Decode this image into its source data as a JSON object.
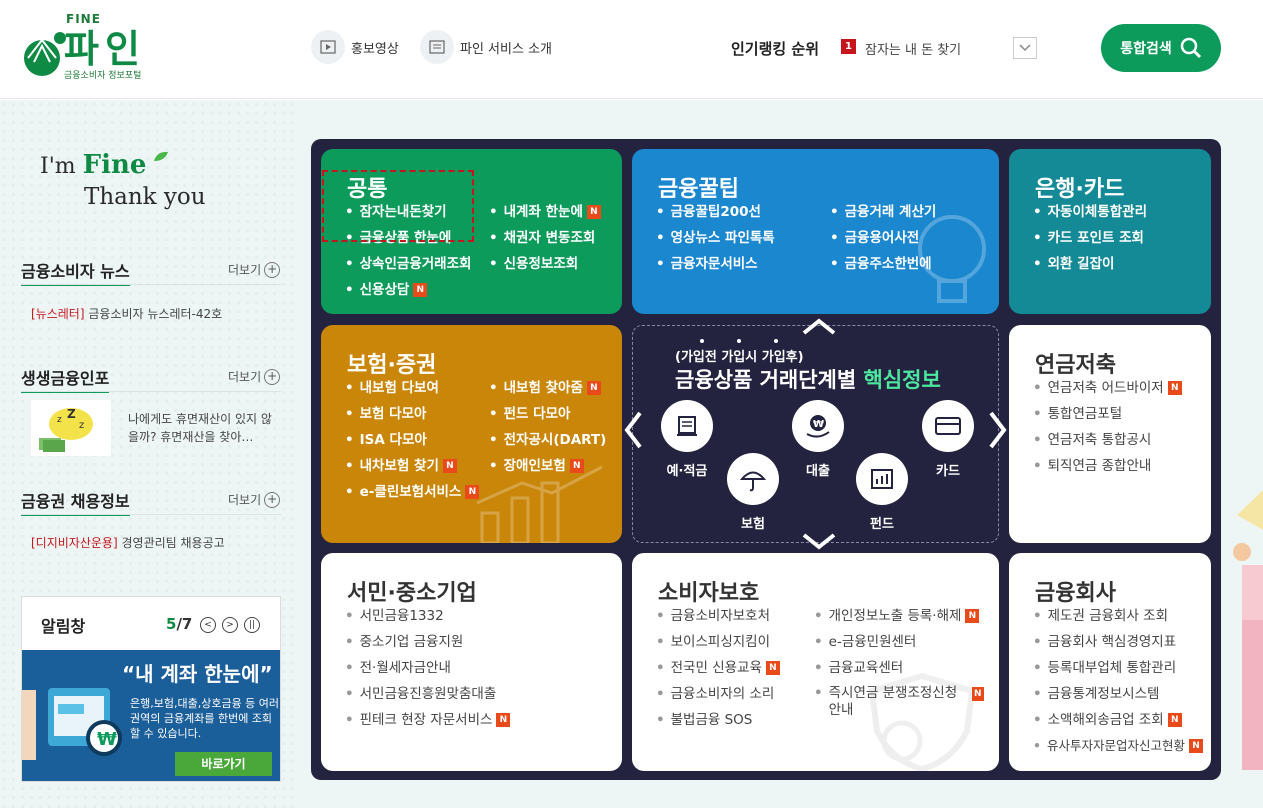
{
  "header": {
    "logo_top": "FINE",
    "logo_name": "파인",
    "logo_sub": "금융소비자 정보포털",
    "promo_video": "홍보영상",
    "service_intro": "파인 서비스 소개",
    "ranking_label": "인기랭킹 순위",
    "ranking_no": "1",
    "ranking_text": "잠자는 내 돈 찾기",
    "search_button": "통합검색"
  },
  "slogan": {
    "im": "I'm",
    "fine": "Fine",
    "thanks": "Thank you"
  },
  "left": {
    "news": {
      "title": "금융소비자 뉴스",
      "more": "더보기",
      "tag": "[뉴스레터]",
      "text": "금융소비자 뉴스레터-42호"
    },
    "info": {
      "title": "생생금융인포",
      "more": "더보기",
      "text": "나에게도 휴면재산이 있지 않을까? 휴면재산을 찾아…"
    },
    "jobs": {
      "title": "금융권 채용정보",
      "more": "더보기",
      "tag": "[디지비자산운용]",
      "text": "경영관리팀 채용공고"
    },
    "alarm": {
      "title": "알림창",
      "current": "5",
      "total": "/7",
      "banner_headline": "“내 계좌 한눈에”",
      "banner_desc": "은행,보험,대출,상호금융 등 여러 권역의 금융계좌를 한번에 조회 할 수 있습니다.",
      "banner_button": "바로가기"
    }
  },
  "boxes": {
    "common": {
      "title": "공통",
      "col1": [
        "잠자는내돈찾기",
        "금융상품 한눈에",
        "상속인금융거래조회",
        "신용상담"
      ],
      "col2": [
        "내계좌 한눈에",
        "채권자 변동조회",
        "신용정보조회"
      ]
    },
    "tips": {
      "title": "금융꿀팁",
      "col1": [
        "금융꿀팁200선",
        "영상뉴스 파인톡톡",
        "금융자문서비스"
      ],
      "col2": [
        "금융거래 계산기",
        "금융용어사전",
        "금융주소한번에"
      ]
    },
    "bank": {
      "title": "은행·카드",
      "col1": [
        "자동이체통합관리",
        "카드 포인트 조회",
        "외환 길잡이"
      ]
    },
    "insurance": {
      "title": "보험·증권",
      "col1": [
        "내보험 다보여",
        "보험 다모아",
        "ISA 다모아",
        "내차보험 찾기",
        "e-클린보험서비스"
      ],
      "col2": [
        "내보험 찾아줌",
        "펀드 다모아",
        "전자공시(DART)",
        "장애인보험"
      ]
    },
    "center": {
      "sub": "(가입전 가입시 가입후)",
      "title": "금융상품 거래단계별 ",
      "highlight": "핵심정보",
      "products": [
        "예·적금",
        "대출",
        "카드",
        "보험",
        "펀드"
      ]
    },
    "pension": {
      "title": "연금저축",
      "col1": [
        "연금저축 어드바이저",
        "통합연금포털",
        "연금저축 통합공시",
        "퇴직연금 종합안내"
      ]
    },
    "sme": {
      "title": "서민·중소기업",
      "col1": [
        "서민금융1332",
        "중소기업 금융지원",
        "전·월세자금안내",
        "서민금융진흥원맞춤대출",
        "핀테크 현장 자문서비스"
      ]
    },
    "protection": {
      "title": "소비자보호",
      "col1": [
        "금융소비자보호처",
        "보이스피싱지킴이",
        "전국민 신용교육",
        "금융소비자의 소리",
        "불법금융 SOS"
      ],
      "col2": [
        "개인정보노출 등록·해제",
        "e-금융민원센터",
        "금융교육센터",
        "즉시연금 분쟁조정신청 안내"
      ]
    },
    "company": {
      "title": "금융회사",
      "col1": [
        "제도권 금융회사 조회",
        "금융회사 핵심경영지표",
        "등록대부업체 통합관리",
        "금융통계정보시스템",
        "소액해외송금업 조회",
        "유사투자자문업자신고현황"
      ]
    },
    "new_badge": "N"
  },
  "colors": {
    "green": "#0d9b5c",
    "blue": "#1a87cf",
    "teal": "#138a96",
    "gold": "#c98608",
    "navy": "#24233f",
    "new": "#e84a1a"
  }
}
